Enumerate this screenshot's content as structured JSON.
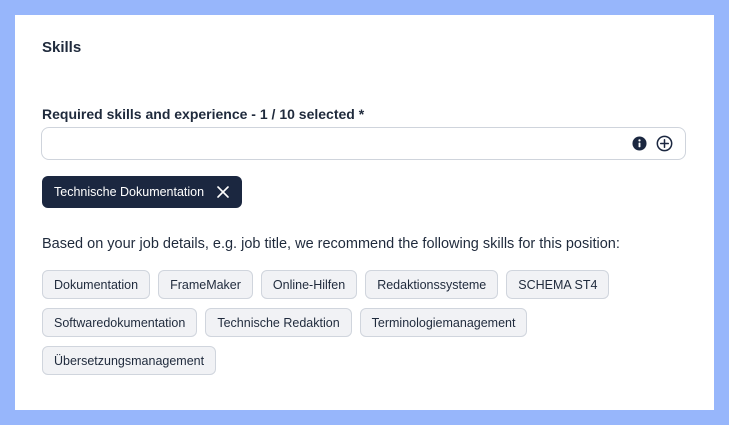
{
  "section": {
    "title": "Skills"
  },
  "skills_field": {
    "label": "Required skills and experience - 1 / 10 selected *",
    "value": "",
    "placeholder": "",
    "icons": {
      "info": "info-icon",
      "add": "add-circle-icon"
    }
  },
  "selected": [
    {
      "label": "Technische Dokumentation",
      "icon": "close-icon"
    }
  ],
  "recommendations": {
    "text": "Based on your job details, e.g. job title, we recommend the following skills for this position:",
    "chips": [
      "Dokumentation",
      "FrameMaker",
      "Online-Hilfen",
      "Redaktionssysteme",
      "SCHEMA ST4",
      "Softwaredokumentation",
      "Technische Redaktion",
      "Terminologiemanagement",
      "Übersetzungsmanagement"
    ]
  },
  "colors": {
    "page_background": "#97b6fb",
    "card": "#ffffff",
    "selected_tag": "#1b2740",
    "chip_background": "#f1f2f5",
    "chip_border": "#d0d5dd",
    "text": "#1f2a3c"
  }
}
